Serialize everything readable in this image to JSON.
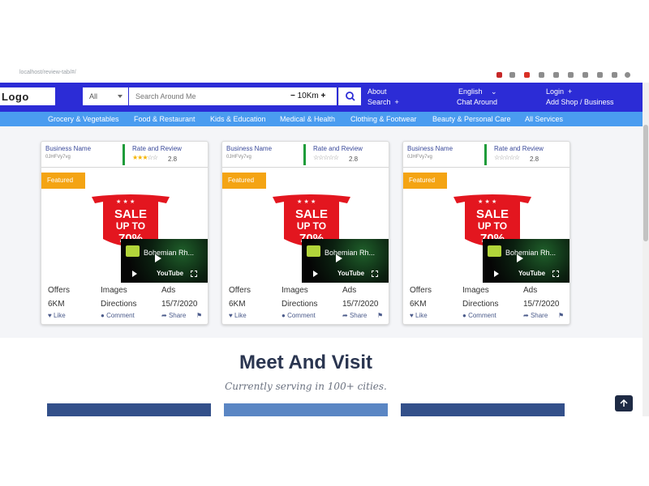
{
  "browser": {
    "url": "localhost/review-tab/#/"
  },
  "header": {
    "logo": "Logo",
    "category": "All",
    "search_placeholder": "Search Around Me",
    "distance": "10Km",
    "about": "About",
    "search": "Search",
    "language": "English",
    "chat": "Chat Around",
    "login": "Login",
    "add_shop": "Add Shop / Business"
  },
  "categories": [
    "Grocery & Vegetables",
    "Food & Restaurant",
    "Kids & Education",
    "Medical & Health",
    "Clothing & Footwear",
    "Beauty & Personal Care",
    "All Services"
  ],
  "cards": [
    {
      "business_label": "Business Name",
      "business_id": "0JHFVy7vg",
      "rating_label": "Rate and Review",
      "rating": 2.8,
      "rating_text": "2.8",
      "filled_stars": 3,
      "featured": "Featured",
      "sale_line1": "SALE",
      "sale_line2": "UP TO",
      "sale_line3": "70%",
      "video_title": "Bohemian Rh...",
      "video_brand": "YouTube",
      "offers": "Offers",
      "images": "Images",
      "ads": "Ads",
      "distance": "6KM",
      "directions": "Directions",
      "date": "15/7/2020",
      "like": "Like",
      "comment": "Comment",
      "share": "Share"
    },
    {
      "business_label": "Business Name",
      "business_id": "0JHFVy7vg",
      "rating_label": "Rate and Review",
      "rating": 2.8,
      "rating_text": "2.8",
      "filled_stars": 0,
      "featured": "Featured",
      "sale_line1": "SALE",
      "sale_line2": "UP TO",
      "sale_line3": "70%",
      "video_title": "Bohemian Rh...",
      "video_brand": "YouTube",
      "offers": "Offers",
      "images": "Images",
      "ads": "Ads",
      "distance": "6KM",
      "directions": "Directions",
      "date": "15/7/2020",
      "like": "Like",
      "comment": "Comment",
      "share": "Share"
    },
    {
      "business_label": "Business Name",
      "business_id": "0JHFVy7vg",
      "rating_label": "Rate and Review",
      "rating": 2.8,
      "rating_text": "2.8",
      "filled_stars": 0,
      "featured": "Featured",
      "sale_line1": "SALE",
      "sale_line2": "UP TO",
      "sale_line3": "70%",
      "video_title": "Bohemian Rh...",
      "video_brand": "YouTube",
      "offers": "Offers",
      "images": "Images",
      "ads": "Ads",
      "distance": "6KM",
      "directions": "Directions",
      "date": "15/7/2020",
      "like": "Like",
      "comment": "Comment",
      "share": "Share"
    }
  ],
  "meet": {
    "title": "Meet And Visit",
    "subtitle": "Currently serving in 100+ cities."
  },
  "colors": {
    "navbar": "#2c2cd6",
    "category_bar": "#4a9cf0",
    "featured": "#f4a413",
    "rating_divider": "#1e9c3a",
    "sale_red": "#e3161f"
  },
  "icons": [
    "search-icon",
    "plus-icon",
    "minus-icon",
    "chevron-down-icon",
    "heart-icon",
    "comment-icon",
    "share-icon",
    "flag-icon",
    "play-icon",
    "fullscreen-icon",
    "arrow-up-icon",
    "star-icon"
  ]
}
